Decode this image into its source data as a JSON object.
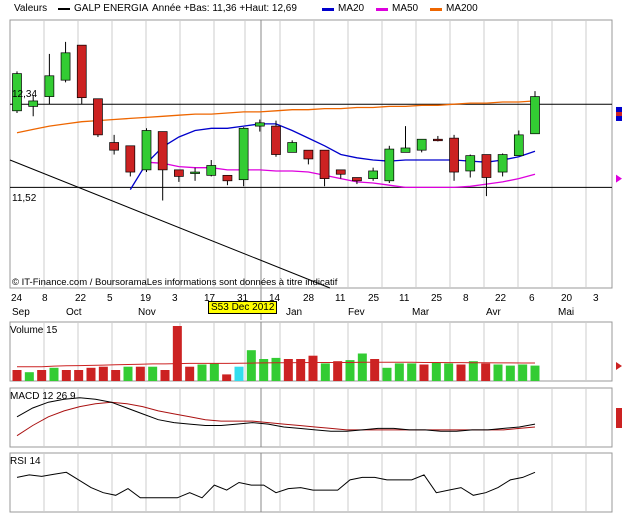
{
  "header": {
    "title": "Valeurs",
    "stock": "GALP ENERGIA",
    "range": "Année +Bas: 11,36 +Haut: 12,69",
    "ma20": "MA20",
    "ma50": "MA50",
    "ma200": "MA200"
  },
  "colors": {
    "up": "#33cc33",
    "down": "#cc2222",
    "ma20": "#0000cc",
    "ma50": "#dd00dd",
    "ma200": "#ee6600",
    "grid": "#cccccc",
    "highlight": "#ffff00",
    "volume_special": "#33ddee"
  },
  "watermark": "© IT-Finance.com / BoursoramaLes informations sont données à titre indicatif",
  "price_labels": {
    "upper": "12,34",
    "lower": "11,52"
  },
  "cursor_date": "S53 Dec 2012",
  "x_axis": {
    "days": [
      "24",
      "8",
      "22",
      "5",
      "19",
      "3",
      "17",
      "31",
      "14",
      "28",
      "11",
      "25",
      "11",
      "25",
      "8",
      "22",
      "6",
      "20",
      "3"
    ],
    "months": [
      "Sep",
      "Oct",
      "Nov",
      "Jan",
      "Fev",
      "Mar",
      "Avr",
      "Mai"
    ]
  },
  "volume_label": "Volume 15",
  "macd_label": "MACD 12 26 9",
  "rsi_label": "RSI 14",
  "chart_data": [
    {
      "type": "candlestick",
      "name": "GALP ENERGIA",
      "ylim": [
        10.6,
        13.05
      ],
      "reference_levels": [
        12.28,
        11.52
      ],
      "candles": [
        {
          "o": 12.22,
          "h": 12.58,
          "l": 12.2,
          "c": 12.56
        },
        {
          "o": 12.26,
          "h": 12.36,
          "l": 12.17,
          "c": 12.31
        },
        {
          "o": 12.35,
          "h": 12.74,
          "l": 12.28,
          "c": 12.54
        },
        {
          "o": 12.5,
          "h": 12.85,
          "l": 12.48,
          "c": 12.75
        },
        {
          "o": 12.82,
          "h": 12.82,
          "l": 12.28,
          "c": 12.34
        },
        {
          "o": 12.33,
          "h": 12.33,
          "l": 11.98,
          "c": 12.0
        },
        {
          "o": 11.93,
          "h": 12.0,
          "l": 11.82,
          "c": 11.86
        },
        {
          "o": 11.9,
          "h": 11.9,
          "l": 11.62,
          "c": 11.66
        },
        {
          "o": 11.68,
          "h": 12.06,
          "l": 11.66,
          "c": 12.04
        },
        {
          "o": 12.03,
          "h": 12.03,
          "l": 11.4,
          "c": 11.68
        },
        {
          "o": 11.68,
          "h": 11.68,
          "l": 11.57,
          "c": 11.62
        },
        {
          "o": 11.65,
          "h": 11.7,
          "l": 11.58,
          "c": 11.66
        },
        {
          "o": 11.63,
          "h": 11.77,
          "l": 11.62,
          "c": 11.72
        },
        {
          "o": 11.63,
          "h": 11.63,
          "l": 11.54,
          "c": 11.58
        },
        {
          "o": 11.59,
          "h": 12.07,
          "l": 11.53,
          "c": 12.06
        },
        {
          "o": 12.08,
          "h": 12.14,
          "l": 12.03,
          "c": 12.11
        },
        {
          "o": 12.08,
          "h": 12.13,
          "l": 11.8,
          "c": 11.82
        },
        {
          "o": 11.84,
          "h": 11.95,
          "l": 11.84,
          "c": 11.93
        },
        {
          "o": 11.86,
          "h": 11.86,
          "l": 11.73,
          "c": 11.78
        },
        {
          "o": 11.86,
          "h": 11.86,
          "l": 11.53,
          "c": 11.6
        },
        {
          "o": 11.68,
          "h": 11.68,
          "l": 11.6,
          "c": 11.64
        },
        {
          "o": 11.61,
          "h": 11.61,
          "l": 11.55,
          "c": 11.58
        },
        {
          "o": 11.6,
          "h": 11.7,
          "l": 11.58,
          "c": 11.67
        },
        {
          "o": 11.58,
          "h": 11.9,
          "l": 11.56,
          "c": 11.87
        },
        {
          "o": 11.84,
          "h": 12.08,
          "l": 11.84,
          "c": 11.88
        },
        {
          "o": 11.86,
          "h": 11.94,
          "l": 11.84,
          "c": 11.96
        },
        {
          "o": 11.96,
          "h": 11.99,
          "l": 11.94,
          "c": 11.95
        },
        {
          "o": 11.97,
          "h": 12.0,
          "l": 11.58,
          "c": 11.66
        },
        {
          "o": 11.67,
          "h": 11.82,
          "l": 11.61,
          "c": 11.81
        },
        {
          "o": 11.82,
          "h": 11.82,
          "l": 11.44,
          "c": 11.61
        },
        {
          "o": 11.66,
          "h": 11.83,
          "l": 11.62,
          "c": 11.82
        },
        {
          "o": 11.81,
          "h": 12.04,
          "l": 11.81,
          "c": 12.0
        },
        {
          "o": 12.01,
          "h": 12.4,
          "l": 12.01,
          "c": 12.35
        }
      ],
      "ma20": [
        null,
        null,
        null,
        null,
        null,
        null,
        null,
        11.5,
        11.74,
        11.89,
        11.98,
        12.04,
        12.06,
        12.06,
        12.08,
        12.1,
        12.1,
        12.04,
        11.97,
        11.9,
        11.82,
        11.79,
        11.77,
        11.76,
        11.77,
        11.77,
        11.77,
        11.77,
        11.76,
        11.75,
        11.77,
        11.8,
        11.85
      ],
      "ma50": [
        null,
        null,
        null,
        null,
        null,
        null,
        null,
        null,
        11.75,
        11.74,
        11.71,
        11.7,
        11.7,
        11.68,
        11.68,
        11.68,
        11.67,
        11.67,
        11.66,
        11.63,
        11.6,
        11.57,
        11.56,
        11.54,
        11.52,
        11.52,
        11.52,
        11.52,
        11.53,
        11.55,
        11.57,
        11.6,
        11.64
      ],
      "ma200": [
        12.02,
        12.05,
        12.08,
        12.1,
        12.12,
        12.13,
        12.14,
        12.15,
        12.16,
        12.17,
        12.18,
        12.19,
        12.19,
        12.2,
        12.21,
        12.21,
        12.22,
        12.23,
        12.23,
        12.24,
        12.24,
        12.25,
        12.25,
        12.26,
        12.26,
        12.27,
        12.27,
        12.28,
        12.29,
        12.29,
        12.3,
        12.3,
        12.31
      ]
    },
    {
      "type": "bar",
      "name": "Volume 15",
      "ylim": [
        0,
        5
      ],
      "values": [
        1,
        0.8,
        1,
        1.2,
        1,
        1,
        1.2,
        1.3,
        1,
        1.3,
        1.3,
        1.3,
        1,
        5,
        1.3,
        1.5,
        1.6,
        0.6,
        1.3,
        2.8,
        2,
        2.1,
        2,
        2,
        2.3,
        1.6,
        1.8,
        1.9,
        2.5,
        2,
        1.2,
        1.6,
        1.6,
        1.5,
        1.7,
        1.6,
        1.5,
        1.8,
        1.6,
        1.5,
        1.4,
        1.5,
        1.4
      ],
      "up": [
        false,
        true,
        false,
        true,
        false,
        false,
        false,
        false,
        false,
        true,
        false,
        true,
        false,
        false,
        false,
        true,
        true,
        false,
        true,
        true,
        true,
        true,
        false,
        false,
        false,
        true,
        false,
        true,
        true,
        false,
        true,
        true,
        true,
        false,
        true,
        true,
        false,
        true,
        false,
        true,
        true,
        true,
        true
      ],
      "special_index": 18,
      "average": [
        1.3,
        1.3,
        1.3,
        1.35,
        1.38,
        1.4,
        1.42,
        1.45,
        1.47,
        1.5,
        1.52,
        1.55,
        1.55,
        1.58,
        1.6,
        1.6,
        1.6,
        1.6,
        1.62,
        1.63,
        1.65,
        1.66,
        1.66,
        1.67,
        1.68,
        1.68,
        1.68,
        1.68,
        1.7,
        1.7,
        1.7,
        1.7,
        1.7,
        1.68,
        1.68,
        1.67,
        1.67,
        1.66,
        1.66,
        1.65,
        1.65,
        1.64,
        1.64
      ]
    },
    {
      "type": "line",
      "name": "MACD 12 26 9",
      "ylim": [
        -0.1,
        0.25
      ],
      "macd": [
        0.08,
        0.14,
        0.18,
        0.2,
        0.21,
        0.2,
        0.18,
        0.14,
        0.1,
        0.06,
        0.04,
        0.03,
        0.02,
        0.02,
        0.03,
        0.04,
        0.03,
        0.01,
        0,
        -0.01,
        -0.02,
        -0.02,
        -0.01,
        0,
        0,
        -0.01,
        -0.01,
        -0.02,
        -0.02,
        -0.01,
        -0.01,
        0,
        0.01,
        0.03
      ],
      "signal": [
        -0.05,
        0.02,
        0.08,
        0.12,
        0.15,
        0.17,
        0.18,
        0.17,
        0.15,
        0.12,
        0.1,
        0.08,
        0.06,
        0.05,
        0.05,
        0.05,
        0.04,
        0.03,
        0.02,
        0.01,
        0,
        -0.01,
        -0.01,
        -0.01,
        -0.01,
        -0.01,
        -0.01,
        -0.01,
        -0.01,
        -0.01,
        -0.01,
        -0.01,
        0,
        0.01
      ]
    },
    {
      "type": "line",
      "name": "RSI 14",
      "ylim": [
        0,
        100
      ],
      "values": [
        60,
        65,
        62,
        66,
        70,
        55,
        40,
        30,
        25,
        38,
        20,
        20,
        20,
        20,
        30,
        20,
        45,
        35,
        50,
        45,
        45,
        30,
        38,
        40,
        35,
        35,
        35,
        55,
        60,
        60,
        55,
        55,
        55,
        65,
        30,
        35,
        40,
        25,
        30,
        40,
        55,
        60,
        70
      ]
    }
  ]
}
